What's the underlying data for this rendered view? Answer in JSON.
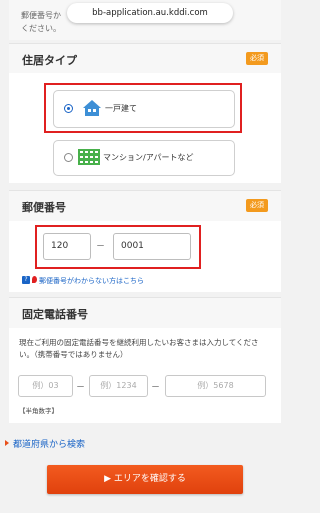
{
  "browser": {
    "url": "bb-application.au.kddi.com"
  },
  "top_text": "郵便番号か　　　　　　　　　　　検索して\nください。",
  "housing": {
    "title": "住居タイプ",
    "required": "必須",
    "options": [
      {
        "label": "一戸建て",
        "selected": true
      },
      {
        "label": "マンション/アパートなど",
        "selected": false
      }
    ]
  },
  "postal": {
    "title": "郵便番号",
    "required": "必須",
    "first": "120",
    "separator": "－",
    "second": "0001",
    "help_link": "郵便番号がわからない方はこちら"
  },
  "phone": {
    "title": "固定電話番号",
    "description": "現在ご利用の固定電話番号を継続利用したいお客さまは入力してください。（携帯番号ではありません）",
    "placeholders": [
      "例）03",
      "例）1234",
      "例）5678"
    ],
    "separator": "－",
    "note": "【半角数字】"
  },
  "prefecture_link": "都道府県から検索",
  "confirm_button": "▶ エリアを確認する",
  "colors": {
    "accent": "#f39a1e",
    "highlight": "#e02020",
    "cta": "#e8501a",
    "link": "#1a64c6"
  }
}
